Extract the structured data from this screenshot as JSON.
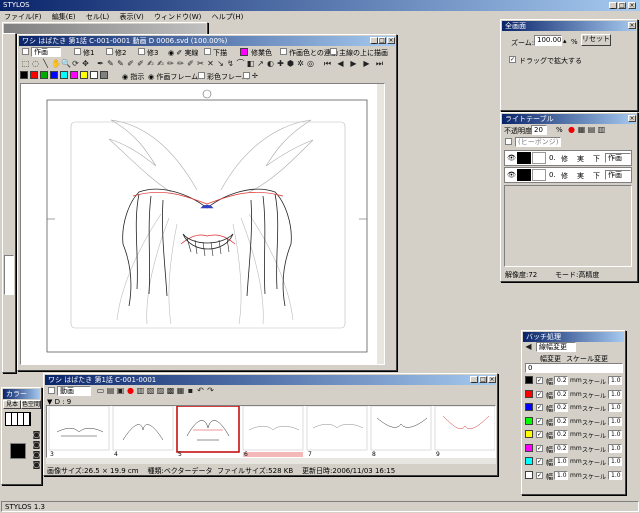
{
  "app": {
    "title": "STYLOS",
    "status": "STYLOS 1.3"
  },
  "menu": [
    "ファイル(F)",
    "編集(E)",
    "セル(L)",
    "表示(V)",
    "ウィンドウ(W)",
    "ヘルプ(H)"
  ],
  "main_window": {
    "title": "ワシ はばたき 第1話 C-001-0001 動画 D 0006.svd (100.00%)",
    "layer_select": "作画",
    "layers": [
      "修1",
      "修2",
      "修3"
    ],
    "line_real": "実線",
    "line_under": "下描",
    "trace_color": "修業色",
    "opt1": "作画色との連動",
    "opt2": "主線の上に描画",
    "row3": {
      "indicate": "指示",
      "frame": "作画フレーム",
      "color_frame": "彩色フレーム"
    }
  },
  "zoom_panel": {
    "title": "全画面",
    "label": "ズーム:",
    "value": "100.00",
    "unit": "%",
    "reset": "リセット",
    "drag": "ドラッグで拡大する"
  },
  "light_table": {
    "title": "ライトテーブル",
    "opacity_label": "不透明度:",
    "opacity_value": "20",
    "opacity_unit": "%",
    "select_placeholder": "(ヒーボンジ)",
    "rows": [
      {
        "num": "0.",
        "flags": [
          "修",
          "実",
          "下"
        ],
        "mode": "作画"
      },
      {
        "num": "0.",
        "flags": [
          "修",
          "実",
          "下"
        ],
        "mode": "作画"
      }
    ],
    "status": {
      "res": "解像度:72",
      "mode": "モード:高精度"
    }
  },
  "batch": {
    "title": "バッチ処理",
    "mode": "線幅変更",
    "headers": [
      "幅変更",
      "スケール変更"
    ],
    "first_value": "0",
    "colors": [
      "#000000",
      "#ff0000",
      "#0000ff",
      "#00ff00",
      "#ffff00",
      "#ff00ff",
      "#00ffff",
      "#ffffff"
    ],
    "width_label": "幅",
    "width_values": [
      "0.2",
      "0.2",
      "0.2",
      "0.2",
      "0.2",
      "0.2",
      "1.0",
      "1.0"
    ],
    "unit": "mm",
    "scale_label": "スケール",
    "scale_values": [
      "1.0",
      "1.0",
      "1.0",
      "1.0",
      "1.0",
      "1.0",
      "1.0",
      "1.0"
    ]
  },
  "timeline": {
    "title": "ワシ はばたき 第1話 C-001-0001",
    "select": "動画",
    "label": "D : 9",
    "frames": [
      "3",
      "4",
      "5",
      "6",
      "7",
      "8",
      "9"
    ],
    "info": {
      "size_label": "画像サイズ:",
      "size": "26.5 × 19.9 cm",
      "type_label": "種類:",
      "type": "ベクターデータ",
      "fsize_label": "ファイルサイズ:",
      "fsize": "528 KB",
      "date_label": "更新日時:",
      "date": "2006/11/03 16:15"
    }
  },
  "color_panel": {
    "title": "カラー",
    "tabs": [
      "見本",
      "色空間"
    ]
  },
  "palette": [
    "#000000",
    "#ff0000",
    "#00aa00",
    "#0000ff",
    "#00ffff",
    "#ff00ff",
    "#ffff00",
    "#ffffff",
    "#808080"
  ]
}
